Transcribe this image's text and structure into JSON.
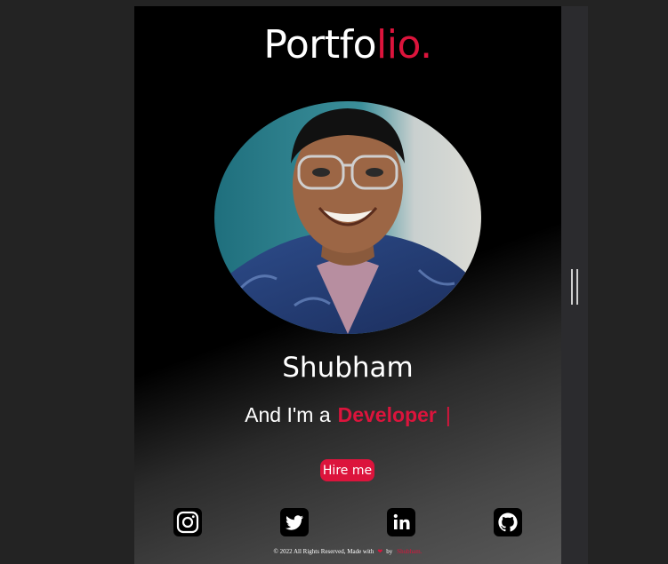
{
  "header": {
    "logo_main": "Portfo",
    "logo_accent": "lio."
  },
  "profile": {
    "name": "Shubham",
    "tagline_prefix": "And I'm a",
    "role": "Developer",
    "cursor": "|",
    "hire_label": "Hire me"
  },
  "social": [
    {
      "icon": "instagram-icon"
    },
    {
      "icon": "twitter-icon"
    },
    {
      "icon": "linkedin-icon"
    },
    {
      "icon": "github-icon"
    }
  ],
  "footer": {
    "text": "© 2022 All Rights Reserved, Made with",
    "heart": "❤",
    "by": "by",
    "author": "Shubham."
  },
  "colors": {
    "accent": "#dc143c",
    "background": "#000000",
    "text": "#ffffff"
  }
}
